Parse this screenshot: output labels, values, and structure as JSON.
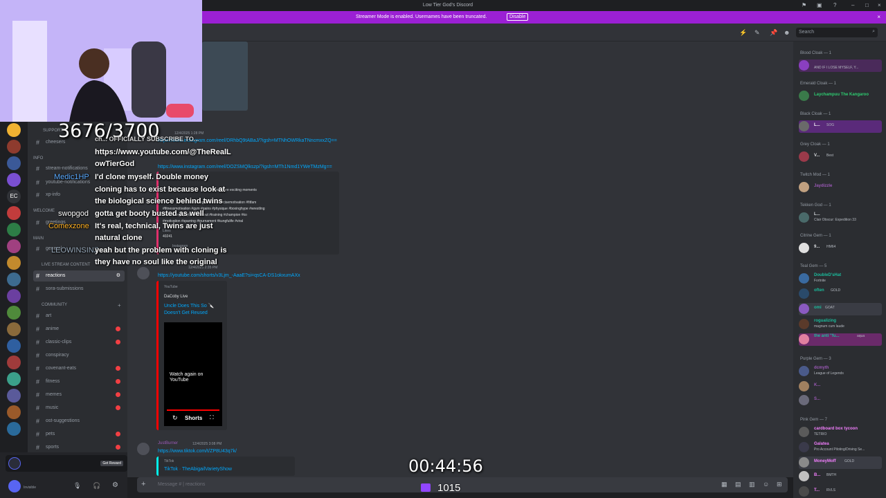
{
  "window": {
    "title": "Low Tier God's Discord"
  },
  "streamer_banner": {
    "message": "Streamer Mode is enabled. Usernames have been truncated.",
    "button": "Disable"
  },
  "header": {
    "search_placeholder": "Search"
  },
  "channels": {
    "categories": [
      "SUPPORT",
      "INFO",
      "WELCOME",
      "MAIN",
      "LIVE STREAM CONTENT",
      "COMMUNITY"
    ],
    "items": [
      {
        "name": "cheesers"
      },
      {
        "name": "stream-notifications"
      },
      {
        "name": "youtube-notifications"
      },
      {
        "name": "xp-info"
      },
      {
        "name": "greetings"
      },
      {
        "name": "general"
      },
      {
        "name": "reactions",
        "selected": true
      },
      {
        "name": "sora-submissions"
      },
      {
        "name": "art"
      },
      {
        "name": "anime"
      },
      {
        "name": "classic-clips"
      },
      {
        "name": "conspiracy"
      },
      {
        "name": "covenant-eats"
      },
      {
        "name": "fitness"
      },
      {
        "name": "memes"
      },
      {
        "name": "music"
      },
      {
        "name": "ost-suggestions"
      },
      {
        "name": "pets"
      },
      {
        "name": "sports"
      }
    ],
    "promo_button": "Get Reward",
    "user_status": "Invisible"
  },
  "chat": {
    "messages": [
      {
        "time": "12/4/2025 1:28 PM",
        "link1": "https://www.instagram.com/reel/DRhbQ9tABaJ/?igsh=MTNhOWRkaTNncmxxZQ==",
        "link2": "https://www.instagram.com/reel/DOZSMQlkszp/?igsh=MTh1Nmd1YWeTMzMg==",
        "embed_title": "even more exciting moments",
        "tags1": "#conditioning #train #exercisemotivation #fitfam",
        "tags2": "#fitnessmotivation #gym #gains #physique #boxinghype #wrestling",
        "tags3": "#kickboxing #jiujitsu #workout #training #champion #ko",
        "tags4": "#motivation #sparring #tournament #kungfulife #viral",
        "likes_label": "Likes",
        "likes": "40241",
        "source": "Instagram"
      },
      {
        "time": "12/4/2025 2:35 PM",
        "link": "https://youtube.com/shorts/v3Ljm_-AaaE?si=qsCA-DS1okxumAXx",
        "provider": "YouTube",
        "author": "DaCoby Live",
        "title": "Uncle Does This So 🔪 Doesn't Get Reused",
        "watch": "Watch again on YouTube",
        "shorts": "Shorts"
      },
      {
        "author": "JustBurner",
        "time": "12/4/2025 3:08 PM",
        "link": "https://www.tiktok.com/t/ZP8U43q7k/",
        "provider": "TikTok",
        "title": "TikTok · TheAbigailVarietyShow"
      }
    ],
    "composer_placeholder": "Message # | reactions"
  },
  "members": {
    "groups": [
      {
        "role": "Blood Cloak — 1",
        "members": [
          {
            "name": "",
            "status": "AND IF I LOSE MYSELF, Y..."
          }
        ]
      },
      {
        "role": "Emerald Cloak — 1",
        "members": [
          {
            "name": "Laychampuu The Kangaroo",
            "status": ""
          }
        ]
      },
      {
        "role": "Black Cloak — 1",
        "members": [
          {
            "name": "L...",
            "status": "SOG"
          }
        ]
      },
      {
        "role": "Grey Cloak — 1",
        "members": [
          {
            "name": "V...",
            "status": "Best"
          }
        ]
      },
      {
        "role": "Twitch Mod — 1",
        "members": [
          {
            "name": "Jaydizzle",
            "status": ""
          }
        ]
      },
      {
        "role": "Tekken God — 1",
        "members": [
          {
            "name": "L...",
            "status": "Clair Obscur: Expedition 33"
          }
        ]
      },
      {
        "role": "Citrine Gem — 1",
        "members": [
          {
            "name": "9...",
            "status": "HM64"
          }
        ]
      },
      {
        "role": "Teal Gem — 5",
        "members": [
          {
            "name": "DoubleD'sHat",
            "status": "Fortnite"
          },
          {
            "name": "often",
            "status": "GOLD"
          },
          {
            "name": "omi",
            "status": "GOAT"
          },
          {
            "name": "rogualizing",
            "status": "magnum cum laude"
          },
          {
            "name": "the anti \"fu...",
            "status": "aqua"
          }
        ]
      },
      {
        "role": "Purple Gem — 3",
        "members": [
          {
            "name": "dcmyth",
            "status": "League of Legends"
          },
          {
            "name": "K...",
            "status": ""
          },
          {
            "name": "S...",
            "status": ""
          }
        ]
      },
      {
        "role": "Pink Gem — 7",
        "members": [
          {
            "name": "cardboard box tycoon",
            "status": "TETRIO"
          },
          {
            "name": "Galatea",
            "status": "Pro Account Piloting/Driving Se..."
          },
          {
            "name": "MoneyMoff",
            "status": "GOLD"
          },
          {
            "name": "B...",
            "status": "BMTH"
          },
          {
            "name": "T...",
            "status": "RVLS"
          }
        ]
      }
    ]
  },
  "overlay": {
    "sub_goal": "3676/3700",
    "timer": "00:44:56",
    "viewers": "1015",
    "chat_lines": [
      {
        "user": "",
        "text": "ch... OFFICIALLY SUBSCRIBE TO..."
      },
      {
        "user": "",
        "text": "https://www.youtube.com/@TheRealL"
      },
      {
        "user": "",
        "text": "owTierGod"
      },
      {
        "user": "Medic1HP",
        "text": "I'd clone myself. Double money"
      },
      {
        "user": "",
        "text": "cloning has to exist because look at"
      },
      {
        "user": "",
        "text": "the biological science behind twins"
      },
      {
        "user": "swopgod",
        "text": "gotta get booty busted as well"
      },
      {
        "user": "Comexzone",
        "text": "It's real, technical, Twins are just"
      },
      {
        "user": "",
        "text": "natural clone"
      },
      {
        "user": "LEOWINSINZ",
        "text": "yeah but the problem with cloning is"
      },
      {
        "user": "",
        "text": "they have no soul like the original"
      }
    ]
  },
  "colors": {
    "accent": "#9b20d4",
    "link": "#00a8fc",
    "bg_chat": "#313338",
    "bg_sidebar": "#2b2d31"
  }
}
